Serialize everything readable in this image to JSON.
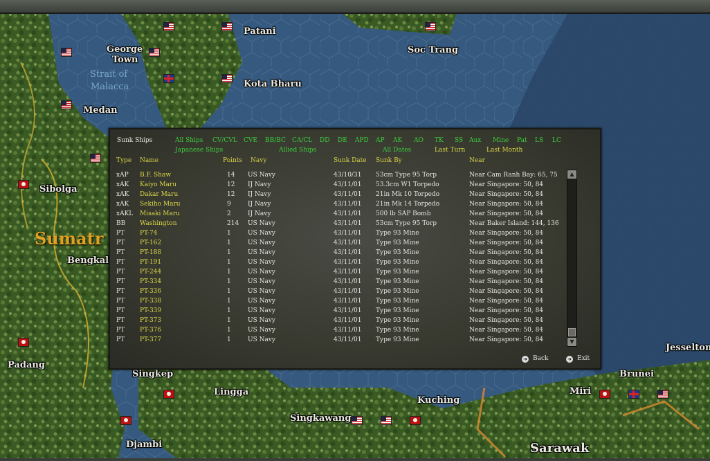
{
  "map": {
    "labels": [
      {
        "text": "Patani",
        "id": "patani"
      },
      {
        "text": "George",
        "id": "george"
      },
      {
        "text": "Town",
        "id": "town"
      },
      {
        "text": "Strait of",
        "id": "strait1"
      },
      {
        "text": "Malacca",
        "id": "strait2"
      },
      {
        "text": "Kota Bharu",
        "id": "kota-bharu"
      },
      {
        "text": "Medan",
        "id": "medan"
      },
      {
        "text": "Soc Trang",
        "id": "soc-trang"
      },
      {
        "text": "Sibolga",
        "id": "sibolga"
      },
      {
        "text": "Sumatr",
        "id": "sumatra"
      },
      {
        "text": "Bengkalis",
        "id": "bengkalis"
      },
      {
        "text": "Padang",
        "id": "padang"
      },
      {
        "text": "Singkep",
        "id": "singkep"
      },
      {
        "text": "Lingga",
        "id": "lingga"
      },
      {
        "text": "Singkawang",
        "id": "singkawang"
      },
      {
        "text": "Kuching",
        "id": "kuching"
      },
      {
        "text": "Djambi",
        "id": "djambi"
      },
      {
        "text": "Sarawak",
        "id": "sarawak"
      },
      {
        "text": "Miri",
        "id": "miri"
      },
      {
        "text": "Brunei",
        "id": "brunei"
      },
      {
        "text": "Jesselton",
        "id": "jesselton"
      }
    ]
  },
  "panel": {
    "title": "Sunk Ships",
    "filters_row1": [
      "All Ships",
      "CV/CVL",
      "CVE",
      "BB/BC",
      "CA/CL",
      "DD",
      "DE",
      "APD",
      "AP",
      "AK",
      "AO",
      "TK",
      "SS",
      "Aux",
      "Mine",
      "Pat",
      "LS",
      "LC"
    ],
    "filters_row2": [
      "Japanese Ships",
      "Allied Ships",
      "All Dates",
      "Last Turn",
      "Last Month"
    ],
    "headers": {
      "type": "Type",
      "name": "Name",
      "points": "Points",
      "navy": "Navy",
      "date": "Sunk Date",
      "by": "Sunk By",
      "near": "Near"
    },
    "rows": [
      {
        "type": "xAP",
        "name": "B.F. Shaw",
        "points": "14",
        "navy": "US Navy",
        "date": "43/10/31",
        "by": "53cm Type 95 Torp",
        "near": "Near Cam Ranh Bay: 65, 75"
      },
      {
        "type": "xAK",
        "name": "Kaiyo Maru",
        "points": "12",
        "navy": "IJ Navy",
        "date": "43/11/01",
        "by": "53.3cm W1 Torpedo",
        "near": "Near Singapore: 50, 84"
      },
      {
        "type": "xAK",
        "name": "Dakar Maru",
        "points": "12",
        "navy": "IJ Navy",
        "date": "43/11/01",
        "by": "21in Mk 10 Torpedo",
        "near": "Near Singapore: 50, 84"
      },
      {
        "type": "xAK",
        "name": "Sekiho Maru",
        "points": "9",
        "navy": "IJ Navy",
        "date": "43/11/01",
        "by": "21in Mk 14 Torpedo",
        "near": "Near Singapore: 50, 84"
      },
      {
        "type": "xAKL",
        "name": "Misaki Maru",
        "points": "2",
        "navy": "IJ Navy",
        "date": "43/11/01",
        "by": "500 lb SAP Bomb",
        "near": "Near Singapore: 50, 84"
      },
      {
        "type": "BB",
        "name": "Washington",
        "points": "214",
        "navy": "US Navy",
        "date": "43/11/01",
        "by": "53cm Type 95 Torp",
        "near": "Near Baker Island: 144, 136"
      },
      {
        "type": "PT",
        "name": "PT-74",
        "points": "1",
        "navy": "US Navy",
        "date": "43/11/01",
        "by": "Type 93 Mine",
        "near": "Near Singapore: 50, 84"
      },
      {
        "type": "PT",
        "name": "PT-162",
        "points": "1",
        "navy": "US Navy",
        "date": "43/11/01",
        "by": "Type 93 Mine",
        "near": "Near Singapore: 50, 84"
      },
      {
        "type": "PT",
        "name": "PT-188",
        "points": "1",
        "navy": "US Navy",
        "date": "43/11/01",
        "by": "Type 93 Mine",
        "near": "Near Singapore: 50, 84"
      },
      {
        "type": "PT",
        "name": "PT-191",
        "points": "1",
        "navy": "US Navy",
        "date": "43/11/01",
        "by": "Type 93 Mine",
        "near": "Near Singapore: 50, 84"
      },
      {
        "type": "PT",
        "name": "PT-244",
        "points": "1",
        "navy": "US Navy",
        "date": "43/11/01",
        "by": "Type 93 Mine",
        "near": "Near Singapore: 50, 84"
      },
      {
        "type": "PT",
        "name": "PT-334",
        "points": "1",
        "navy": "US Navy",
        "date": "43/11/01",
        "by": "Type 93 Mine",
        "near": "Near Singapore: 50, 84"
      },
      {
        "type": "PT",
        "name": "PT-336",
        "points": "1",
        "navy": "US Navy",
        "date": "43/11/01",
        "by": "Type 93 Mine",
        "near": "Near Singapore: 50, 84"
      },
      {
        "type": "PT",
        "name": "PT-338",
        "points": "1",
        "navy": "US Navy",
        "date": "43/11/01",
        "by": "Type 93 Mine",
        "near": "Near Singapore: 50, 84"
      },
      {
        "type": "PT",
        "name": "PT-339",
        "points": "1",
        "navy": "US Navy",
        "date": "43/11/01",
        "by": "Type 93 Mine",
        "near": "Near Singapore: 50, 84"
      },
      {
        "type": "PT",
        "name": "PT-373",
        "points": "1",
        "navy": "US Navy",
        "date": "43/11/01",
        "by": "Type 93 Mine",
        "near": "Near Singapore: 50, 84"
      },
      {
        "type": "PT",
        "name": "PT-376",
        "points": "1",
        "navy": "US Navy",
        "date": "43/11/01",
        "by": "Type 93 Mine",
        "near": "Near Singapore: 50, 84"
      },
      {
        "type": "PT",
        "name": "PT-377",
        "points": "1",
        "navy": "US Navy",
        "date": "43/11/01",
        "by": "Type 93 Mine",
        "near": "Near Singapore: 50, 84"
      }
    ],
    "back_label": "Back",
    "exit_label": "Exit",
    "colors": {
      "filter_green": "#3ccf3c",
      "header_yellow": "#d8d44a",
      "ship_name_yellow": "#dcd84a",
      "text": "#e6e6e0"
    }
  }
}
